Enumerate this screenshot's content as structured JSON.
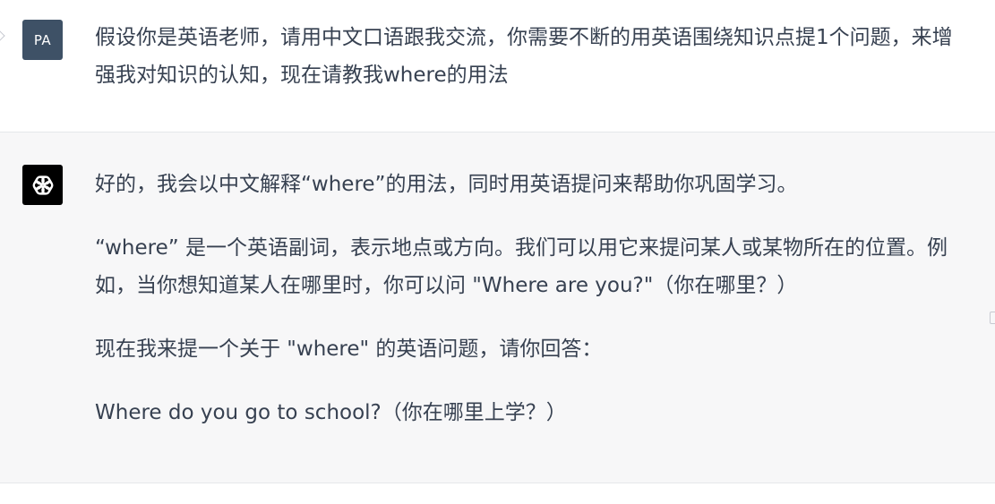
{
  "user_message": {
    "avatar_initials": "PA",
    "text": "假设你是英语老师，请用中文口语跟我交流，你需要不断的用英语围绕知识点提1个问题，来增强我对知识的认知，现在请教我where的用法"
  },
  "assistant_message": {
    "avatar_icon": "openai-logo-icon",
    "paragraphs": [
      "好的，我会以中文解释“where”的用法，同时用英语提问来帮助你巩固学习。",
      "“where” 是一个英语副词，表示地点或方向。我们可以用它来提问某人或某物所在的位置。例如，当你想知道某人在哪里时，你可以问 \"Where are you?\"（你在哪里？）",
      "现在我来提一个关于 \"where\" 的英语问题，请你回答：",
      "Where do you go to school?（你在哪里上学？）"
    ]
  },
  "colors": {
    "user_avatar_bg": "#3e5166",
    "assistant_avatar_bg": "#000000",
    "assistant_row_bg": "#f7f7f8",
    "text": "#374151"
  }
}
